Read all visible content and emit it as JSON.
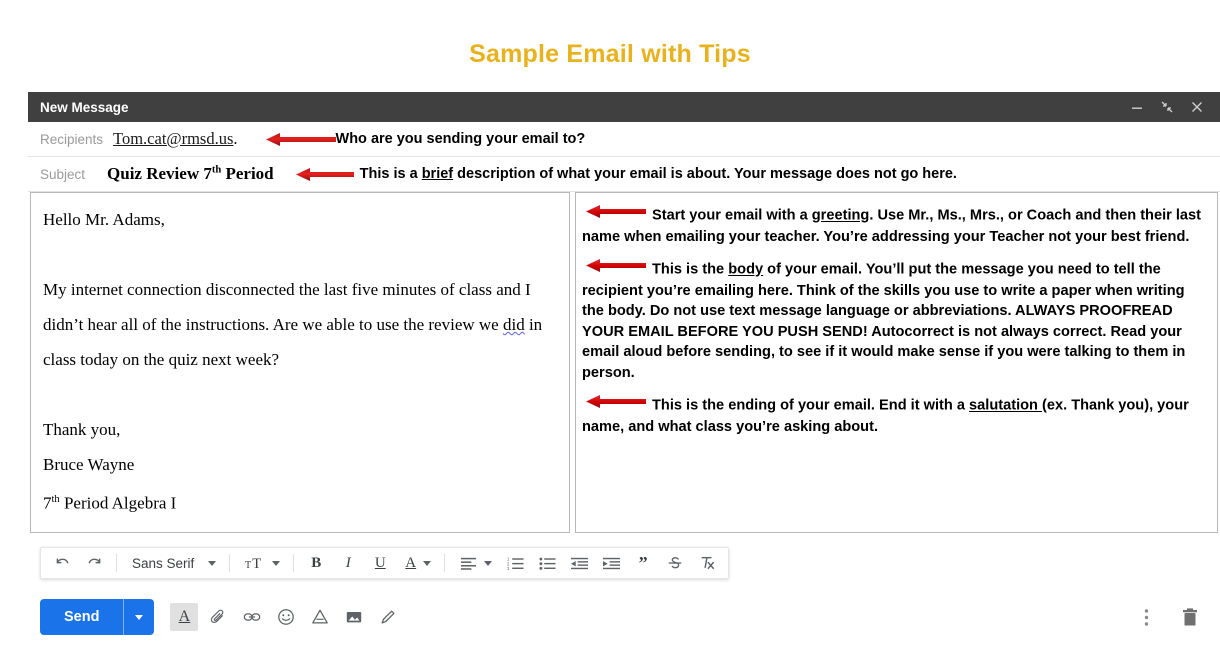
{
  "page": {
    "title": "Sample Email with Tips",
    "title_color": "#E8B21E"
  },
  "compose": {
    "window_title": "New Message",
    "window_controls": [
      {
        "name": "minimize-button",
        "icon": "minimize-icon"
      },
      {
        "name": "maximize-button",
        "icon": "expand-icon"
      },
      {
        "name": "close-button",
        "icon": "close-icon"
      }
    ],
    "recipients": {
      "label": "Recipients",
      "value": "Tom.cat@rmsd.us",
      "trailing_period": ".",
      "annotation": "Who are you sending your email to?"
    },
    "subject": {
      "label": "Subject",
      "value_main": "Quiz Review 7",
      "value_sup": "th",
      "value_tail": " Period",
      "annotation_pre": "This is a ",
      "annotation_underlined": "brief",
      "annotation_post": " description of what your email is about.  Your message does not go here."
    },
    "body": {
      "greeting": "Hello Mr. Adams,",
      "paragraph_pre": "My internet connection disconnected the last five minutes of class and I didn’t hear all of the instructions.  Are we able to use the review we ",
      "paragraph_misspelled": "did",
      "paragraph_post": " in class today on the quiz next week?",
      "closing": "Thank you,",
      "signer": "Bruce Wayne",
      "class_main": "7",
      "class_sup": "th",
      "class_tail": " Period Algebra I"
    },
    "tips": [
      {
        "name": "tip-greeting",
        "pre": "Start your email with a ",
        "underlined": "greeting",
        "post": ".  Use Mr., Ms., Mrs., or Coach and then their last name when emailing your teacher. You’re addressing your Teacher not your best friend."
      },
      {
        "name": "tip-body",
        "pre": "This is the ",
        "underlined": "body",
        "post": " of your email.  You’ll put the message you need to tell the recipient you’re emailing here.  Think of the skills you use to write a paper when writing the body.  Do not use text message language or abbreviations.  ALWAYS PROOFREAD YOUR EMAIL BEFORE YOU PUSH SEND! Autocorrect is not always correct.  Read your email aloud before sending, to see if it would make sense if you were talking to them in person."
      },
      {
        "name": "tip-salutation",
        "pre": "This is the ending of your email.  End it with a ",
        "underlined": "salutation ",
        "post": "(ex. Thank you), your name, and what class you’re asking about."
      }
    ],
    "format_toolbar": {
      "undo_label": "undo-icon",
      "redo_label": "redo-icon",
      "font_name": "Sans Serif",
      "font_size_label": "font-size-icon",
      "bold_label": "B",
      "italic_label": "I",
      "underline_label": "U",
      "text_color_label": "A",
      "align_label": "align-icon",
      "numbered_list_label": "numbered-list-icon",
      "bulleted_list_label": "bulleted-list-icon",
      "indent_less_label": "indent-less-icon",
      "indent_more_label": "indent-more-icon",
      "quote_label": "”",
      "strikethrough_label": "S",
      "remove_format_label": "remove-formatting-icon"
    },
    "actions": {
      "send_label": "Send",
      "send_caret_name": "send-options-caret",
      "icons": [
        {
          "name": "formatting-options-button",
          "label": "A"
        },
        {
          "name": "attach-file-button",
          "label": "paperclip-icon"
        },
        {
          "name": "insert-link-button",
          "label": "link-icon"
        },
        {
          "name": "insert-emoji-button",
          "label": "emoji-icon"
        },
        {
          "name": "insert-drive-file-button",
          "label": "drive-icon"
        },
        {
          "name": "insert-photo-button",
          "label": "image-icon"
        },
        {
          "name": "insert-signature-button",
          "label": "pen-icon"
        }
      ],
      "more_options_label": "more-options-icon",
      "discard_label": "trash-icon"
    }
  },
  "colors": {
    "arrow_red": "#E01B1B",
    "header_bg": "#404040",
    "send_blue": "#1a73e8",
    "misspell_blue": "#5b5bd6"
  }
}
